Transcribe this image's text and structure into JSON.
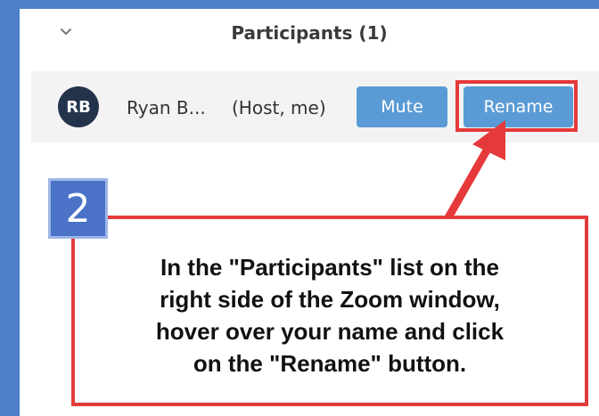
{
  "panel": {
    "title": "Participants (1)",
    "collapse_icon": "chevron-down-icon"
  },
  "participant": {
    "initials": "RB",
    "name": "Ryan B...",
    "role": "(Host, me)",
    "avatar_color": "#22334b",
    "mute_label": "Mute",
    "rename_label": "Rename"
  },
  "annotation": {
    "step_number": "2",
    "instruction_lines": [
      "In the \"Participants\" list on the",
      "right side of the Zoom window,",
      "hover over your name and click",
      "on the \"Rename\" button."
    ],
    "highlight_color": "#e33b3b",
    "badge_color": "#4a73c8"
  },
  "colors": {
    "button": "#5b9bd5",
    "background": "#4f7fc6"
  }
}
